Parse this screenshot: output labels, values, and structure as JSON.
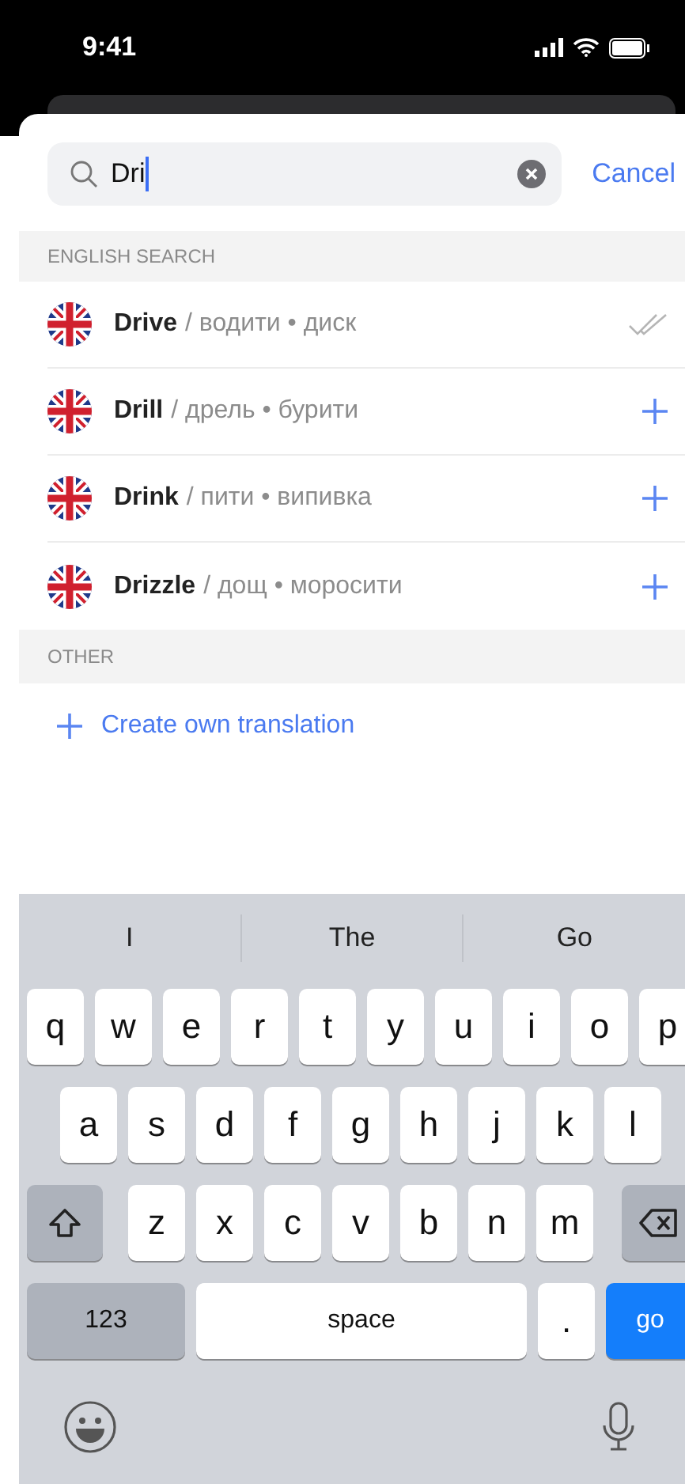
{
  "status_bar": {
    "time": "9:41"
  },
  "search": {
    "value": "Dri",
    "cancel": "Cancel"
  },
  "sections": [
    {
      "title": "ENGLISH SEARCH",
      "kind": "words",
      "items": [
        {
          "word": "Drive",
          "translation": "/ водити • диск",
          "added": true
        },
        {
          "word": "Drill",
          "translation": "/ дрель • бурити",
          "added": false
        },
        {
          "word": "Drink",
          "translation": "/ пити • випивка",
          "added": false
        },
        {
          "word": "Drizzle",
          "translation": "/ дощ • моросити",
          "added": false
        }
      ]
    },
    {
      "title": "OTHER",
      "kind": "actions",
      "items": [
        {
          "label": "Create own translation"
        }
      ]
    }
  ],
  "keyboard": {
    "suggestions": [
      "I",
      "The",
      "Go"
    ],
    "rows": [
      {
        "keys": [
          {
            "kind": "letter",
            "label": "q"
          },
          {
            "kind": "letter",
            "label": "w"
          },
          {
            "kind": "letter",
            "label": "e"
          },
          {
            "kind": "letter",
            "label": "r"
          },
          {
            "kind": "letter",
            "label": "t"
          },
          {
            "kind": "letter",
            "label": "y"
          },
          {
            "kind": "letter",
            "label": "u"
          },
          {
            "kind": "letter",
            "label": "i"
          },
          {
            "kind": "letter",
            "label": "o"
          },
          {
            "kind": "letter",
            "label": "p"
          }
        ]
      },
      {
        "keys": [
          {
            "kind": "letter",
            "label": "a"
          },
          {
            "kind": "letter",
            "label": "s"
          },
          {
            "kind": "letter",
            "label": "d"
          },
          {
            "kind": "letter",
            "label": "f"
          },
          {
            "kind": "letter",
            "label": "g"
          },
          {
            "kind": "letter",
            "label": "h"
          },
          {
            "kind": "letter",
            "label": "j"
          },
          {
            "kind": "letter",
            "label": "k"
          },
          {
            "kind": "letter",
            "label": "l"
          }
        ]
      },
      {
        "keys": [
          {
            "kind": "shift"
          },
          {
            "kind": "letter",
            "label": "z"
          },
          {
            "kind": "letter",
            "label": "x"
          },
          {
            "kind": "letter",
            "label": "c"
          },
          {
            "kind": "letter",
            "label": "v"
          },
          {
            "kind": "letter",
            "label": "b"
          },
          {
            "kind": "letter",
            "label": "n"
          },
          {
            "kind": "letter",
            "label": "m"
          },
          {
            "kind": "backspace"
          }
        ]
      },
      {
        "keys": [
          {
            "kind": "numbers",
            "label": "123"
          },
          {
            "kind": "space",
            "label": "space"
          },
          {
            "kind": "letter",
            "label": "."
          },
          {
            "kind": "go",
            "label": "go"
          }
        ]
      }
    ]
  }
}
